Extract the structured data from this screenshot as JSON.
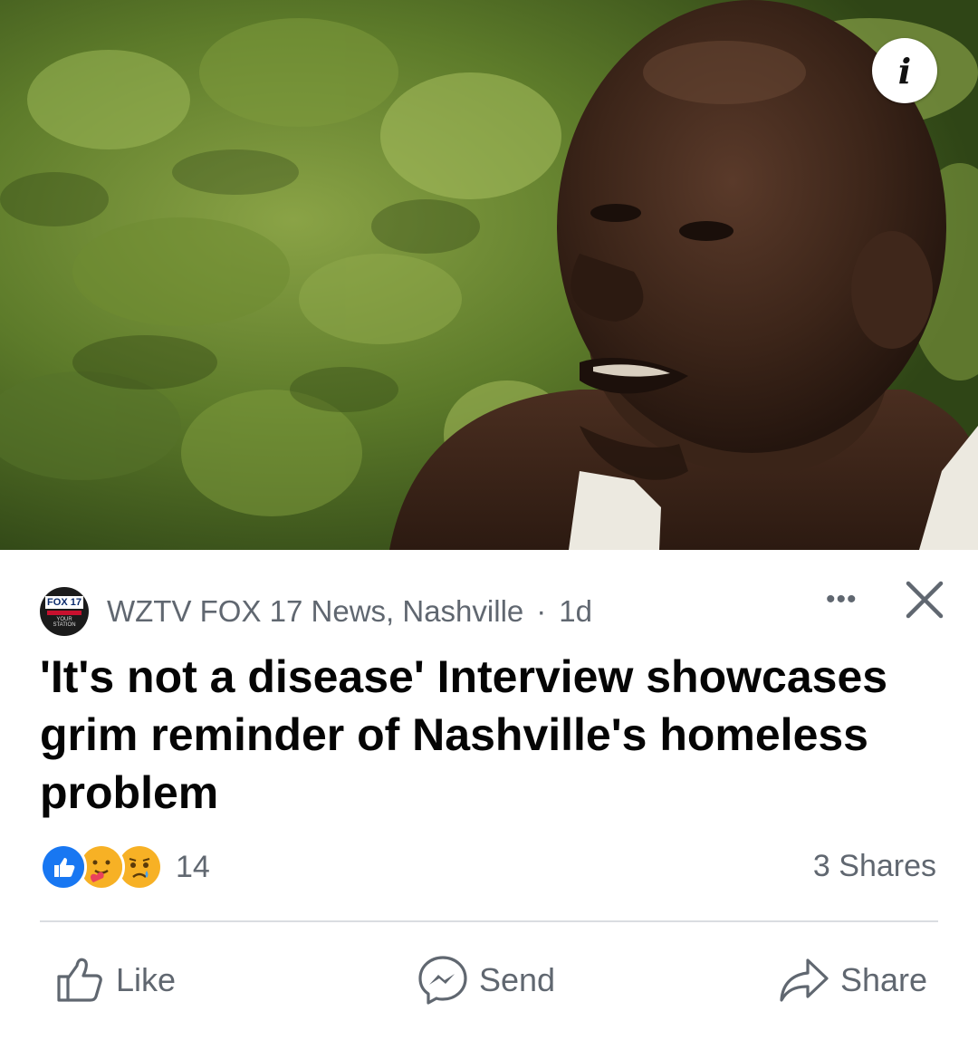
{
  "post": {
    "source_name": "WZTV FOX 17 News, Nashville",
    "separator": "·",
    "age": "1d",
    "logo_text": "FOX 17",
    "logo_subtext": "YOUR STATION",
    "headline": "'It's not a disease' Interview showcases grim reminder of Nashville's homeless problem",
    "more_label": "•••",
    "info_label": "i"
  },
  "engagement": {
    "reaction_icons": [
      "like-reaction-icon",
      "care-reaction-icon",
      "sad-reaction-icon"
    ],
    "reaction_count": "14",
    "shares_text": "3 Shares"
  },
  "actions": {
    "like_label": "Like",
    "send_label": "Send",
    "share_label": "Share"
  },
  "colors": {
    "meta_text": "#606770",
    "headline_text": "#050505",
    "like_blue": "#1877f2",
    "divider": "#dadde1"
  }
}
